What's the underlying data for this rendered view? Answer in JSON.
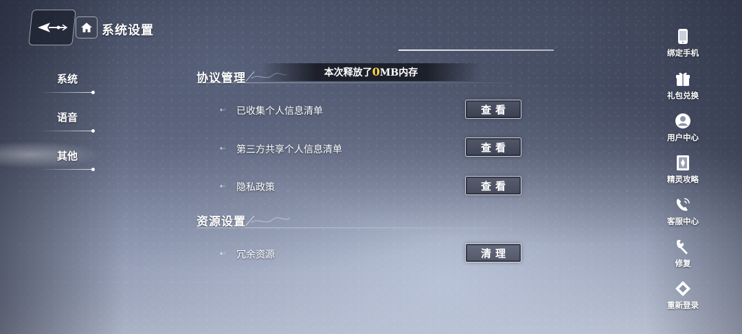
{
  "header": {
    "title": "系统设置"
  },
  "nav": {
    "items": [
      {
        "label": "系统",
        "active": false
      },
      {
        "label": "语音",
        "active": false
      },
      {
        "label": "其他",
        "active": true
      }
    ]
  },
  "toast": {
    "prefix": "本次释放了",
    "value": "0",
    "suffix": "MB内存"
  },
  "sections": {
    "agreement": {
      "title": "协议管理",
      "rows": [
        {
          "label": "已收集个人信息清单",
          "button": "查看"
        },
        {
          "label": "第三方共享个人信息清单",
          "button": "查看"
        },
        {
          "label": "隐私政策",
          "button": "查看"
        }
      ]
    },
    "resources": {
      "title": "资源设置",
      "rows": [
        {
          "label": "冗余资源",
          "button": "清理"
        }
      ]
    }
  },
  "sidebar": {
    "items": [
      {
        "label": "绑定手机",
        "icon": "phone-icon"
      },
      {
        "label": "礼包兑换",
        "icon": "gift-icon"
      },
      {
        "label": "用户中心",
        "icon": "user-icon"
      },
      {
        "label": "精灵攻略",
        "icon": "book-icon"
      },
      {
        "label": "客服中心",
        "icon": "headset-icon"
      },
      {
        "label": "修复",
        "icon": "wrench-icon"
      },
      {
        "label": "重新登录",
        "icon": "relogin-icon"
      }
    ]
  },
  "colors": {
    "highlight": "#f6d64a",
    "text": "#ffffff"
  }
}
